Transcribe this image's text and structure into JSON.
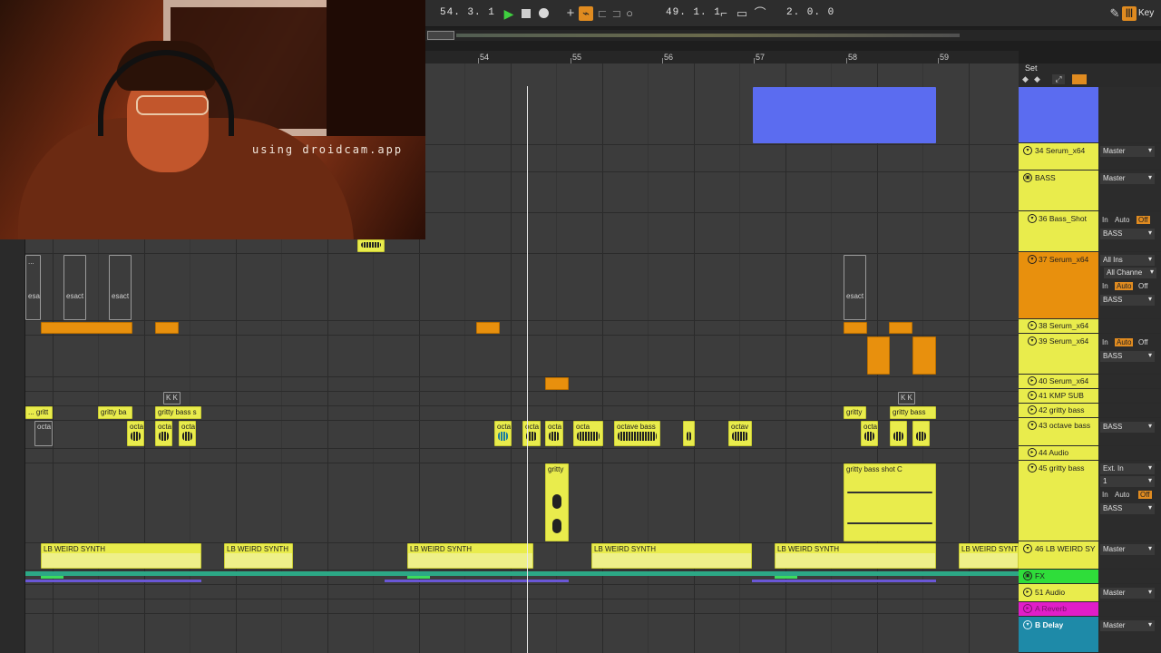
{
  "transport": {
    "arrangement_position": "54. 3. 1",
    "loop_start": "49. 1. 1",
    "loop_length": "2. 0. 0",
    "key_label": "Key"
  },
  "ruler": {
    "bars": [
      "54",
      "55",
      "56",
      "57",
      "58",
      "59"
    ]
  },
  "set": {
    "label": "Set"
  },
  "webcam": {
    "text": "using droidcam.app"
  },
  "clips": {
    "esact": "esact",
    "ellipsis": "...",
    "gritty_a": "... gritt",
    "gritty_b": "gritty ba",
    "gritty_c": "gritty bass s",
    "gritty_d": "gritty",
    "gritty_e": "gritty bass",
    "gritty_shot": "gritty",
    "gritty_shot_c": "gritty bass shot C",
    "octa": "octa",
    "octave_bass": "octave bass",
    "octave": "octav",
    "kk": "K K",
    "lb1": "LB WEIRD SYNTH",
    "lb2": "LB WEIRD SYNTH",
    "lb3": "LB WEIRD SYNTH",
    "lb4": "LB WEIRD SYNTH",
    "lb5": "LB WEIRD SYNTH",
    "lb6": "LB WEIRD SYNT"
  },
  "tracks": [
    {
      "name": "34 Serum_x64",
      "output": "Master"
    },
    {
      "name": "BASS",
      "output": "Master"
    },
    {
      "name": "36 Bass_Shot",
      "input_label": "In",
      "auto_label": "Auto",
      "off_label": "Off",
      "output": "BASS"
    },
    {
      "name": "37 Serum_x64",
      "input": "All Ins",
      "channel": "All Channe",
      "input_label": "In",
      "auto_label": "Auto",
      "off_label": "Off",
      "output": "BASS"
    },
    {
      "name": "38 Serum_x64"
    },
    {
      "name": "39 Serum_x64",
      "input_label": "In",
      "auto_label": "Auto",
      "off_label": "Off",
      "output": "BASS"
    },
    {
      "name": "40 Serum_x64"
    },
    {
      "name": "41 KMP SUB"
    },
    {
      "name": "42 gritty bass"
    },
    {
      "name": "43 octave bass",
      "output": "BASS"
    },
    {
      "name": "44 Audio"
    },
    {
      "name": "45 gritty bass",
      "input": "Ext. In",
      "channel": "1",
      "input_label": "In",
      "auto_label": "Auto",
      "off_label": "Off",
      "output": "BASS"
    },
    {
      "name": "46 LB WEIRD SY",
      "output": "Master"
    },
    {
      "name": "FX"
    },
    {
      "name": "51 Audio",
      "output": "Master"
    },
    {
      "name": "A Reverb"
    },
    {
      "name": "B Delay",
      "output": "Master"
    }
  ],
  "colors": {
    "yellow": "#e9ec4c",
    "orange": "#e8900d",
    "blue": "#5b6cf0",
    "green": "#3ddb5d",
    "magenta": "#e01ec8",
    "teal": "#1e8aa8",
    "accent": "#e08b20"
  }
}
